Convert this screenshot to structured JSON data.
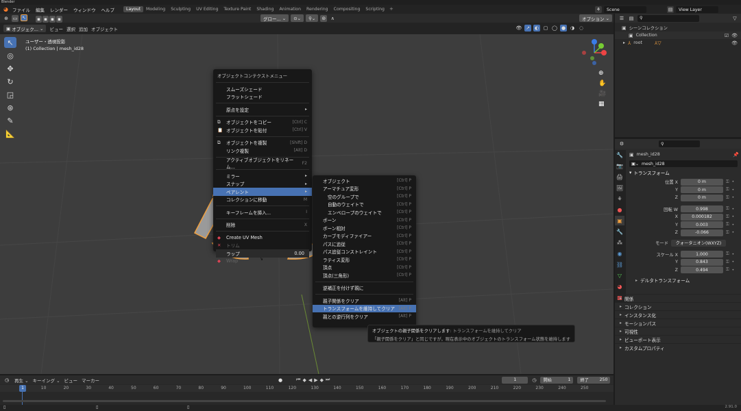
{
  "app": {
    "title": "Blender",
    "version": "2.91.0"
  },
  "topbar": {
    "menus": [
      "ファイル",
      "編集",
      "レンダー",
      "ウィンドウ",
      "ヘルプ"
    ],
    "workspaces": [
      "Layout",
      "Modeling",
      "Sculpting",
      "UV Editing",
      "Texture Paint",
      "Shading",
      "Animation",
      "Rendering",
      "Compositing",
      "Scripting"
    ],
    "active_workspace": "Layout",
    "scene": "Scene",
    "view_layer": "View Layer"
  },
  "viewport_header": {
    "mode": "オブジェク...",
    "menus": [
      "ビュー",
      "選択",
      "追加",
      "オブジェクト"
    ],
    "transform": "グロー...",
    "options": "オプション"
  },
  "viewport": {
    "view_name": "ユーザー・透視投影",
    "collection_info": "(1) Collection | mesh_id28"
  },
  "context_menu": {
    "title": "オブジェクトコンテクストメニュー",
    "items": [
      {
        "label": "スムーズシェード",
        "shortcut": ""
      },
      {
        "label": "フラットシェード",
        "shortcut": ""
      },
      {
        "sep": true
      },
      {
        "label": "原点を設定",
        "shortcut": "",
        "arrow": "▸"
      },
      {
        "sep": true
      },
      {
        "label": "オブジェクトをコピー",
        "shortcut": "[Ctrl] C",
        "icon": "copy"
      },
      {
        "label": "オブジェクトを貼付",
        "shortcut": "[Ctrl] V",
        "icon": "paste"
      },
      {
        "sep": true
      },
      {
        "label": "オブジェクトを複製",
        "shortcut": "[Shift] D",
        "icon": "duplicate"
      },
      {
        "label": "リンク複製",
        "shortcut": "[Alt] D"
      },
      {
        "sep": true
      },
      {
        "label": "アクティブオブジェクトをリネーム...",
        "shortcut": "F2"
      },
      {
        "sep": true
      },
      {
        "label": "ミラー",
        "arrow": "▸"
      },
      {
        "label": "スナップ",
        "arrow": "▸"
      },
      {
        "label": "ペアレント",
        "arrow": "▸",
        "active": true
      },
      {
        "label": "コレクションに移動",
        "shortcut": "M"
      },
      {
        "sep": true
      },
      {
        "label": "キーフレームを挿入...",
        "shortcut": "I"
      },
      {
        "sep": true
      },
      {
        "label": "削除",
        "shortcut": "X"
      },
      {
        "sep": true
      },
      {
        "label": "Create UV Mesh",
        "icon": "uv"
      },
      {
        "label": "トリム",
        "icon": "trim",
        "disabled": true
      },
      {
        "label": "ラップ",
        "value": "0.00",
        "slider": true
      },
      {
        "label": "Wrap",
        "icon": "wrap",
        "disabled": true
      }
    ]
  },
  "parent_submenu": {
    "items": [
      {
        "label": "オブジェクト",
        "shortcut": "[Ctrl] P"
      },
      {
        "label": "アーマチュア変形",
        "shortcut": "[Ctrl] P"
      },
      {
        "label": "空のグループで",
        "shortcut": "[Ctrl] P",
        "indent": true
      },
      {
        "label": "自動のウェイトで",
        "shortcut": "[Ctrl] P",
        "indent": true
      },
      {
        "label": "エンベロープのウェイトで",
        "shortcut": "[Ctrl] P",
        "indent": true
      },
      {
        "label": "ボーン",
        "shortcut": "[Ctrl] P"
      },
      {
        "label": "ボーン相対",
        "shortcut": "[Ctrl] P"
      },
      {
        "label": "カーブモディファイアー",
        "shortcut": "[Ctrl] P"
      },
      {
        "label": "パスに追従",
        "shortcut": "[Ctrl] P"
      },
      {
        "label": "パス追従コンストレイント",
        "shortcut": "[Ctrl] P"
      },
      {
        "label": "ラティス変形",
        "shortcut": "[Ctrl] P"
      },
      {
        "label": "頂点",
        "shortcut": "[Ctrl] P"
      },
      {
        "label": "頂点(三角形)",
        "shortcut": "[Ctrl] P"
      },
      {
        "sep": true
      },
      {
        "label": "逆補正を付けず親に",
        "shortcut": ""
      },
      {
        "sep": true
      },
      {
        "label": "親子関係をクリア",
        "shortcut": "[Alt] P"
      },
      {
        "label": "トランスフォームを維持してクリア",
        "shortcut": "[Alt] P",
        "active": true
      },
      {
        "label": "親との逆行列をクリア",
        "shortcut": "[Alt] P"
      }
    ]
  },
  "tooltip": {
    "line1_main": "オブジェクトの親子関係をクリアします",
    "line1_sub": "トランスフォームを維持してクリア",
    "line2": "「親子関係をクリア」と同じですが，現在表示中のオブジェクトのトランスフォーム状態を維持します"
  },
  "outliner": {
    "root_label": "シーンコレクション",
    "collection": "Collection",
    "item": "root"
  },
  "properties": {
    "object_name": "mesh_id28",
    "data_name": "mesh_id28",
    "transform_header": "トランスフォーム",
    "location": {
      "label": "位置 X",
      "x": "0 m",
      "y": "0 m",
      "z": "0 m"
    },
    "rotation": {
      "label": "回転 W",
      "w": "0.998",
      "x": "0.000182",
      "y": "0.003",
      "z": "-0.066"
    },
    "mode_label": "モード",
    "mode_value": "クォータニオン(WXYZ)",
    "scale": {
      "label": "スケール X",
      "x": "1.000",
      "y": "0.843",
      "z": "0.494"
    },
    "axis_labels": {
      "x": "X",
      "y": "Y",
      "z": "Z"
    },
    "delta": "デルタトランスフォーム",
    "sections": [
      "関係",
      "コレクション",
      "インスタンス化",
      "モーションパス",
      "可視性",
      "ビューポート表示",
      "カスタムプロパティ"
    ]
  },
  "timeline": {
    "menus": [
      "再生",
      "キーイング",
      "ビュー",
      "マーカー"
    ],
    "current_frame": "1",
    "start_label": "開始",
    "start": "1",
    "end_label": "終了",
    "end": "250",
    "ticks": [
      "1",
      "10",
      "20",
      "30",
      "40",
      "50",
      "60",
      "70",
      "80",
      "90",
      "100",
      "110",
      "120",
      "130",
      "140",
      "150",
      "160",
      "170",
      "180",
      "190",
      "200",
      "210",
      "220",
      "230",
      "240",
      "250"
    ]
  },
  "colors": {
    "accent": "#4772b3",
    "orange": "#f0a040",
    "header": "#2b2b2b",
    "bg": "#3d3d3d"
  }
}
